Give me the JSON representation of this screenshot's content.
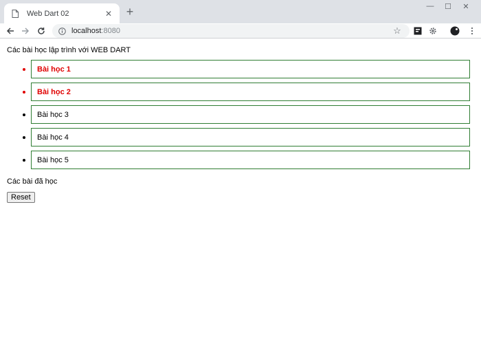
{
  "browser": {
    "tab_title": "Web Dart 02",
    "url_host": "localhost",
    "url_port": ":8080"
  },
  "page": {
    "heading": "Các bài học lập trình với WEB DART",
    "lessons": [
      {
        "label": "Bài học 1",
        "done": true
      },
      {
        "label": "Bài học 2",
        "done": true
      },
      {
        "label": "Bài học 3",
        "done": false
      },
      {
        "label": "Bài học 4",
        "done": false
      },
      {
        "label": "Bài học 5",
        "done": false
      }
    ],
    "learned_heading": "Các bài đã học",
    "reset_label": "Reset"
  },
  "colors": {
    "done_text": "#e00000",
    "item_border": "#2f7d32"
  }
}
